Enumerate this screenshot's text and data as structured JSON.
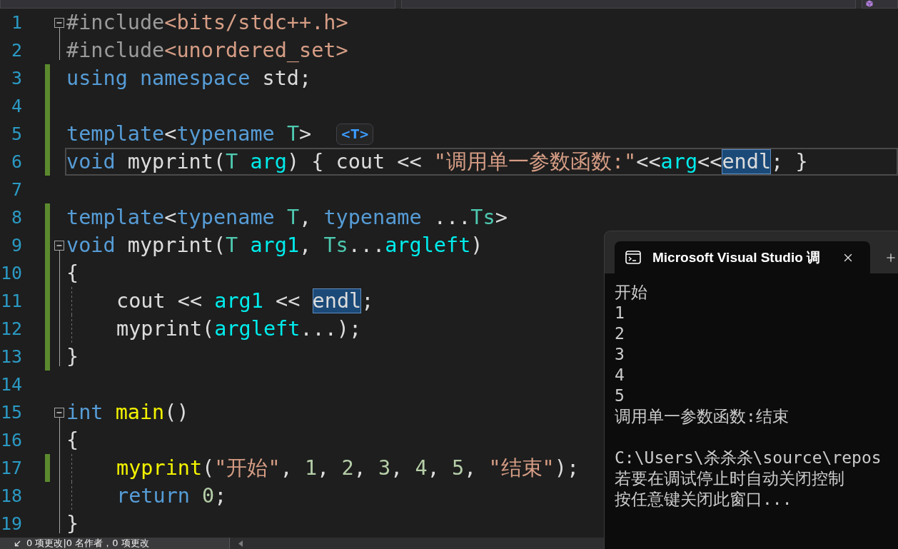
{
  "editor": {
    "lines": [
      {
        "number": "1",
        "expanded": true,
        "changed": false,
        "current": false,
        "indented": false,
        "tokens": [
          {
            "text": "#include",
            "kind": "preprocessor"
          },
          {
            "text": "<bits/stdc++.h>",
            "kind": "string"
          }
        ],
        "children": [
          {
            "number": "2",
            "changed": false,
            "current": false,
            "indented": false,
            "tokens": [
              {
                "text": "#include",
                "kind": "preprocessor"
              },
              {
                "text": "<unordered_set>",
                "kind": "string"
              }
            ]
          }
        ]
      },
      {
        "number": "3",
        "changed": true,
        "current": false,
        "indented": false,
        "tokens": [
          {
            "text": "using",
            "kind": "keyword"
          },
          {
            "text": " namespace",
            "kind": "keyword"
          },
          {
            "text": " std;",
            "kind": "plain"
          }
        ]
      },
      {
        "number": "4",
        "changed": true,
        "current": false,
        "indented": false
      },
      {
        "number": "5",
        "changed": true,
        "current": false,
        "indented": false,
        "hint": "<T>",
        "tokens": [
          {
            "text": "template",
            "kind": "keyword"
          },
          {
            "text": "<",
            "kind": "plain"
          },
          {
            "text": "typename",
            "kind": "keyword"
          },
          {
            "text": " T",
            "kind": "type"
          },
          {
            "text": ">",
            "kind": "plain"
          }
        ]
      },
      {
        "number": "6",
        "changed": true,
        "current": true,
        "indented": false,
        "tokens": [
          {
            "text": "void",
            "kind": "keyword"
          },
          {
            "text": " myprint(",
            "kind": "plain"
          },
          {
            "text": "T",
            "kind": "type"
          },
          {
            "text": " arg",
            "kind": "parameter"
          },
          {
            "text": ") { cout << ",
            "kind": "plain"
          },
          {
            "text": "\"调用单一参数函数:\"",
            "kind": "string"
          },
          {
            "text": "<<",
            "kind": "plain"
          },
          {
            "text": "arg",
            "kind": "parameter"
          },
          {
            "text": "<<",
            "kind": "plain"
          },
          {
            "text": "endl",
            "kind": "highlight"
          },
          {
            "text": "; }",
            "kind": "plain"
          }
        ]
      },
      {
        "number": "7",
        "changed": false,
        "current": false,
        "indented": false
      },
      {
        "number": "8",
        "changed": true,
        "current": false,
        "indented": false,
        "tokens": [
          {
            "text": "template",
            "kind": "keyword"
          },
          {
            "text": "<",
            "kind": "plain"
          },
          {
            "text": "typename",
            "kind": "keyword"
          },
          {
            "text": " T",
            "kind": "type"
          },
          {
            "text": ", ",
            "kind": "plain"
          },
          {
            "text": "typename",
            "kind": "keyword"
          },
          {
            "text": " ...",
            "kind": "plain"
          },
          {
            "text": "Ts",
            "kind": "type"
          },
          {
            "text": ">",
            "kind": "plain"
          }
        ]
      },
      {
        "number": "9",
        "expanded": true,
        "changed": true,
        "current": false,
        "indented": false,
        "tokens": [
          {
            "text": "void",
            "kind": "keyword"
          },
          {
            "text": " myprint(",
            "kind": "plain"
          },
          {
            "text": "T",
            "kind": "type"
          },
          {
            "text": " arg1",
            "kind": "parameter"
          },
          {
            "text": ", ",
            "kind": "plain"
          },
          {
            "text": "Ts",
            "kind": "type"
          },
          {
            "text": "...",
            "kind": "plain"
          },
          {
            "text": "argleft",
            "kind": "parameter"
          },
          {
            "text": ")",
            "kind": "plain"
          }
        ],
        "children": [
          {
            "number": "10",
            "changed": true,
            "current": false,
            "indented": false,
            "tokens": [
              {
                "text": "{",
                "kind": "plain"
              }
            ]
          },
          {
            "number": "11",
            "changed": true,
            "current": false,
            "indented": true,
            "tokens": [
              {
                "text": "cout << ",
                "kind": "plain"
              },
              {
                "text": "arg1",
                "kind": "parameter"
              },
              {
                "text": " << ",
                "kind": "plain"
              },
              {
                "text": "endl",
                "kind": "highlight"
              },
              {
                "text": ";",
                "kind": "plain"
              }
            ]
          },
          {
            "number": "12",
            "changed": true,
            "current": false,
            "indented": true,
            "tokens": [
              {
                "text": "myprint(",
                "kind": "plain"
              },
              {
                "text": "argleft",
                "kind": "parameter"
              },
              {
                "text": "...);",
                "kind": "plain"
              }
            ]
          },
          {
            "number": "13",
            "changed": true,
            "current": false,
            "indented": false,
            "tokens": [
              {
                "text": "}",
                "kind": "plain"
              }
            ]
          }
        ]
      },
      {
        "number": "14",
        "changed": false,
        "current": false,
        "indented": false
      },
      {
        "number": "15",
        "expanded": true,
        "changed": false,
        "current": false,
        "indented": false,
        "tokens": [
          {
            "text": "int",
            "kind": "keyword"
          },
          {
            "text": " main",
            "kind": "function"
          },
          {
            "text": "()",
            "kind": "plain"
          }
        ],
        "children": [
          {
            "number": "16",
            "changed": false,
            "current": false,
            "indented": false,
            "tokens": [
              {
                "text": "{",
                "kind": "plain"
              }
            ]
          },
          {
            "number": "17",
            "changed": true,
            "current": false,
            "indented": true,
            "tokens": [
              {
                "text": "myprint",
                "kind": "function"
              },
              {
                "text": "(",
                "kind": "plain"
              },
              {
                "text": "\"开始\"",
                "kind": "string"
              },
              {
                "text": ", ",
                "kind": "plain"
              },
              {
                "text": "1",
                "kind": "number"
              },
              {
                "text": ", ",
                "kind": "plain"
              },
              {
                "text": "2",
                "kind": "number"
              },
              {
                "text": ", ",
                "kind": "plain"
              },
              {
                "text": "3",
                "kind": "number"
              },
              {
                "text": ", ",
                "kind": "plain"
              },
              {
                "text": "4",
                "kind": "number"
              },
              {
                "text": ", ",
                "kind": "plain"
              },
              {
                "text": "5",
                "kind": "number"
              },
              {
                "text": ", ",
                "kind": "plain"
              },
              {
                "text": "\"结束\"",
                "kind": "string"
              },
              {
                "text": ");",
                "kind": "plain"
              }
            ]
          },
          {
            "number": "18",
            "changed": false,
            "current": false,
            "indented": true,
            "tokens": [
              {
                "text": "return",
                "kind": "keyword"
              },
              {
                "text": " 0",
                "kind": "number"
              },
              {
                "text": ";",
                "kind": "plain"
              }
            ]
          },
          {
            "number": "19",
            "changed": false,
            "current": false,
            "indented": false,
            "tokens": [
              {
                "text": "}",
                "kind": "plain"
              }
            ]
          }
        ]
      }
    ]
  },
  "console": {
    "title": "Microsoft Visual Studio 调",
    "output": [
      "开始",
      "1",
      "2",
      "3",
      "4",
      "5",
      "调用单一参数函数:结束"
    ],
    "exit_message": [
      "C:\\Users\\杀杀杀\\source\\repos",
      "若要在调试停止时自动关闭控制",
      "按任意键关闭此窗口..."
    ]
  },
  "status_bar": {
    "changes": "0 项更改|0 名作者，0 项更改"
  }
}
